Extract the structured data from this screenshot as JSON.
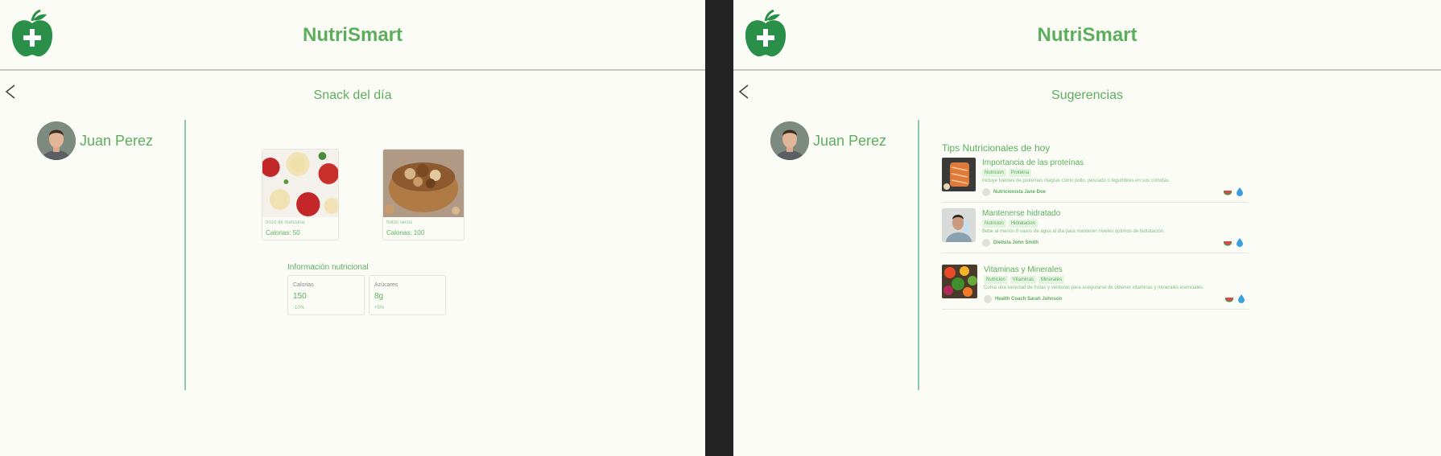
{
  "colors": {
    "brand_green": "#5cae5d",
    "tag_bg": "#e3f4e1",
    "divider": "#8cc7a8",
    "background": "#fcfcf7"
  },
  "left": {
    "app_title": "NutriSmart",
    "page_title": "Snack del día",
    "user_name": "Juan Perez",
    "snacks": [
      {
        "name": "trozo de manzana",
        "calories": "Calorias: 50",
        "icon": "apple-photo"
      },
      {
        "name": "frutos secos",
        "calories": "Calorias: 100",
        "icon": "nuts-photo"
      }
    ],
    "nutrition_title": "Información nutricional",
    "nutrition": [
      {
        "label": "Calorias",
        "value": "150",
        "change": "-10%"
      },
      {
        "label": "Azúcares",
        "value": "8g",
        "change": "+5%"
      }
    ]
  },
  "right": {
    "app_title": "NutriSmart",
    "page_title": "Sugerencias",
    "user_name": "Juan Perez",
    "tips_title": "Tips Nutricionales de hoy",
    "tips": [
      {
        "title": "Importancia de las proteínas",
        "tags": [
          "Nutricion",
          "Proteina"
        ],
        "description": "Incluye fuentes de proteínas magras como pollo, pescado o legumbres en sus comidas.",
        "author": "Nutricionista Jane Doe"
      },
      {
        "title": "Mantenerse hidratado",
        "tags": [
          "Nutricion",
          "Hidratacion"
        ],
        "description": "Bebe al menos 8 vasos de agua al día para mantener niveles óptimos de hidratación.",
        "author": "Dietista John Smith"
      },
      {
        "title": "Vitaminas y Minerales",
        "tags": [
          "Nutricion",
          "Vitaminas",
          "Minerales"
        ],
        "description": "Coma una variedad de frutas y verduras para asegurarse de obtener vitaminas y minerales esenciales.",
        "author": "Health Coach Sarah Johnson"
      }
    ]
  }
}
